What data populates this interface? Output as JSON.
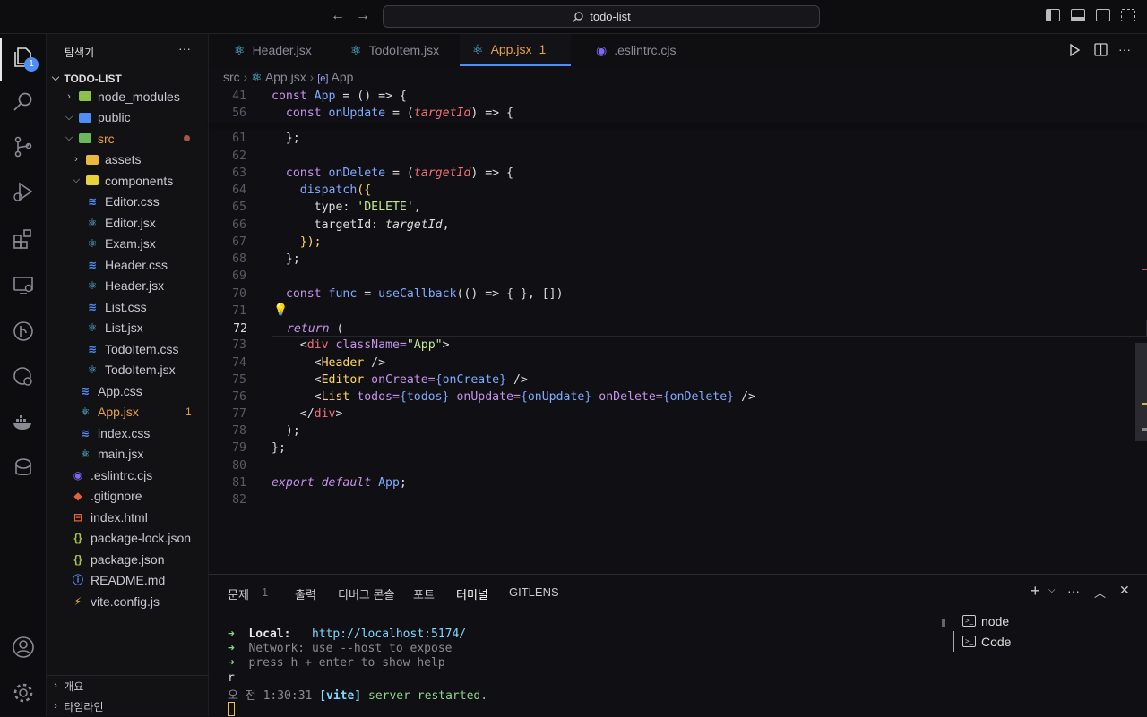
{
  "title": {
    "search_text": "todo-list",
    "back": "←",
    "forward": "→"
  },
  "activity": {
    "badge": "1"
  },
  "sidebar": {
    "title": "탐색기",
    "more": "···",
    "root": "TODO-LIST",
    "items": [
      {
        "label": "node_modules",
        "depth": 1,
        "type": "folder",
        "open": false
      },
      {
        "label": "public",
        "depth": 1,
        "type": "folder",
        "open": true
      },
      {
        "label": "src",
        "depth": 1,
        "type": "folder",
        "open": true,
        "status": "dot"
      },
      {
        "label": "assets",
        "depth": 2,
        "type": "folder",
        "open": false
      },
      {
        "label": "components",
        "depth": 2,
        "type": "folder",
        "open": true
      },
      {
        "label": "Editor.css",
        "depth": 3,
        "type": "css"
      },
      {
        "label": "Editor.jsx",
        "depth": 3,
        "type": "jsx"
      },
      {
        "label": "Exam.jsx",
        "depth": 3,
        "type": "jsx"
      },
      {
        "label": "Header.css",
        "depth": 3,
        "type": "css"
      },
      {
        "label": "Header.jsx",
        "depth": 3,
        "type": "jsx"
      },
      {
        "label": "List.css",
        "depth": 3,
        "type": "css"
      },
      {
        "label": "List.jsx",
        "depth": 3,
        "type": "jsx"
      },
      {
        "label": "TodoItem.css",
        "depth": 3,
        "type": "css"
      },
      {
        "label": "TodoItem.jsx",
        "depth": 3,
        "type": "jsx"
      },
      {
        "label": "App.css",
        "depth": 2,
        "type": "css"
      },
      {
        "label": "App.jsx",
        "depth": 2,
        "type": "jsx",
        "error": "1"
      },
      {
        "label": "index.css",
        "depth": 2,
        "type": "css"
      },
      {
        "label": "main.jsx",
        "depth": 2,
        "type": "jsx"
      },
      {
        "label": ".eslintrc.cjs",
        "depth": 1,
        "type": "eslint"
      },
      {
        "label": ".gitignore",
        "depth": 1,
        "type": "git"
      },
      {
        "label": "index.html",
        "depth": 1,
        "type": "html"
      },
      {
        "label": "package-lock.json",
        "depth": 1,
        "type": "json"
      },
      {
        "label": "package.json",
        "depth": 1,
        "type": "json"
      },
      {
        "label": "README.md",
        "depth": 1,
        "type": "info"
      },
      {
        "label": "vite.config.js",
        "depth": 1,
        "type": "vite"
      }
    ],
    "outline": "개요",
    "timeline": "타임라인"
  },
  "tabs": [
    {
      "label": "Header.jsx",
      "active": false
    },
    {
      "label": "TodoItem.jsx",
      "active": false
    },
    {
      "label": "App.jsx",
      "active": true,
      "error": "1"
    },
    {
      "label": ".eslintrc.cjs",
      "active": false
    }
  ],
  "breadcrumb": {
    "p1": "src",
    "p2": "App.jsx",
    "p3": "App"
  },
  "code": [
    {
      "n": "41",
      "sticky": true
    },
    {
      "n": "56",
      "sticky": true
    },
    {
      "n": "61"
    },
    {
      "n": "62"
    },
    {
      "n": "63"
    },
    {
      "n": "64"
    },
    {
      "n": "65"
    },
    {
      "n": "66"
    },
    {
      "n": "67"
    },
    {
      "n": "68"
    },
    {
      "n": "69"
    },
    {
      "n": "70"
    },
    {
      "n": "71"
    },
    {
      "n": "72"
    },
    {
      "n": "73"
    },
    {
      "n": "74"
    },
    {
      "n": "75"
    },
    {
      "n": "76"
    },
    {
      "n": "77"
    },
    {
      "n": "78"
    },
    {
      "n": "79"
    },
    {
      "n": "80"
    },
    {
      "n": "81"
    },
    {
      "n": "82"
    }
  ],
  "code_text": {
    "l41a": "const ",
    "l41b": "App",
    " l41c": "",
    "l41c": " = () => {",
    "l56a": "  const ",
    "l56b": "onUpdate",
    "l56c": " = (",
    "l56d": "targetId",
    "l56e": ") => {",
    "l61": "  };",
    "l63a": "  const ",
    "l63b": "onDelete",
    "l63c": " = (",
    "l63d": "targetId",
    "l63e": ") => {",
    "l64a": "    ",
    "l64b": "dispatch",
    "l64c": "({",
    "l65a": "      type: ",
    "l65b": "'DELETE'",
    "l65c": ",",
    "l66a": "      targetId: ",
    "l66b": "targetId",
    "l66c": ",",
    "l67": "    });",
    "l68": "  };",
    "l70a": "  const ",
    "l70b": "func",
    "l70c": " = ",
    "l70d": "useCallback",
    "l70e": "(() => { }, [])",
    "l72a": "  ",
    "l72b": "return",
    "l72c": " (",
    "l73a": "    <",
    "l73b": "div",
    "l73c": " className=",
    "l73d": "\"App\"",
    "l73e": ">",
    "l74a": "      <",
    "l74b": "Header",
    "l74c": " />",
    "l75a": "      <",
    "l75b": "Editor",
    "l75c": " onCreate=",
    "l75d": "{onCreate}",
    "l75e": " />",
    "l76a": "      <",
    "l76b": "List",
    "l76c": " todos=",
    "l76d": "{todos}",
    "l76e": " onUpdate=",
    "l76f": "{onUpdate}",
    "l76g": " onDelete=",
    "l76h": "{onDelete}",
    "l76i": " />",
    "l77a": "    </",
    "l77b": "div",
    "l77c": ">",
    "l78": "  );",
    "l79": "};",
    "l81a": "export default ",
    "l81b": "App",
    ";": "",
    "l81c": ";"
  },
  "panel": {
    "tabs": [
      "문제",
      "출력",
      "디버그 콘솔",
      "포트",
      "터미널",
      "GITLENS"
    ],
    "problems_count": "1",
    "terminals": [
      "node",
      "Code"
    ],
    "terminal": {
      "arrow": "➜",
      "local_label": "Local:",
      "local_url": "http://localhost:5174/",
      "network_label": "Network:",
      "network_text": "use --host to expose",
      "help_text": "press h + enter to show help",
      "r": "r",
      "time_prefix": "오 전",
      "time": "1:30:31",
      "vite": "[vite]",
      "restarted": "server restarted."
    }
  }
}
